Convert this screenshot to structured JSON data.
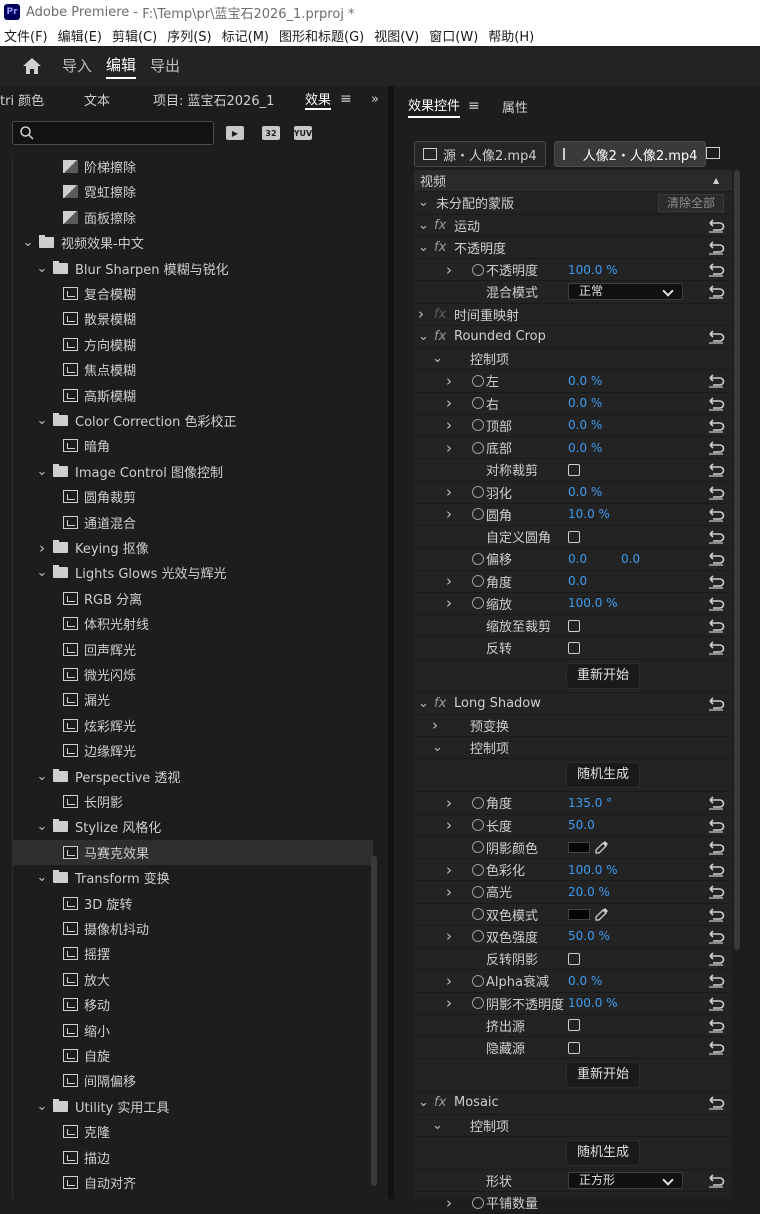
{
  "titlebar": {
    "app": "Adobe Premiere",
    "sep": " - ",
    "path": "F:\\Temp\\pr\\蓝宝石2026_1.prproj *"
  },
  "menu": [
    "文件(F)",
    "编辑(E)",
    "剪辑(C)",
    "序列(S)",
    "标记(M)",
    "图形和标题(G)",
    "视图(V)",
    "窗口(W)",
    "帮助(H)"
  ],
  "workspace": {
    "tabs": [
      "导入",
      "编辑",
      "导出"
    ],
    "active": "编辑"
  },
  "left": {
    "tabs": [
      "tri 颜色",
      "文本",
      "项目: 蓝宝石2026_1",
      "效果"
    ],
    "active_tab": "效果",
    "search_placeholder": "",
    "tool_badges": [
      "32",
      "YUV"
    ],
    "tree": [
      {
        "kind": "tr",
        "indent": 2,
        "label": "阶梯擦除"
      },
      {
        "kind": "tr",
        "indent": 2,
        "label": "霓虹擦除"
      },
      {
        "kind": "tr",
        "indent": 2,
        "label": "面板擦除"
      },
      {
        "kind": "folder",
        "indent": 0,
        "open": true,
        "label": "视频效果-中文"
      },
      {
        "kind": "folder",
        "indent": 1,
        "open": true,
        "label": "Blur  Sharpen 模糊与锐化"
      },
      {
        "kind": "fx",
        "indent": 2,
        "label": "复合模糊"
      },
      {
        "kind": "fx",
        "indent": 2,
        "label": "散景模糊"
      },
      {
        "kind": "fx",
        "indent": 2,
        "label": "方向模糊"
      },
      {
        "kind": "fx",
        "indent": 2,
        "label": "焦点模糊"
      },
      {
        "kind": "fx",
        "indent": 2,
        "label": "高斯模糊"
      },
      {
        "kind": "folder",
        "indent": 1,
        "open": true,
        "label": "Color Correction 色彩校正"
      },
      {
        "kind": "fx",
        "indent": 2,
        "label": "暗角"
      },
      {
        "kind": "folder",
        "indent": 1,
        "open": true,
        "label": "Image Control 图像控制"
      },
      {
        "kind": "fx",
        "indent": 2,
        "label": "圆角裁剪"
      },
      {
        "kind": "fx",
        "indent": 2,
        "label": "通道混合"
      },
      {
        "kind": "folder",
        "indent": 1,
        "open": false,
        "label": "Keying 抠像"
      },
      {
        "kind": "folder",
        "indent": 1,
        "open": true,
        "label": "Lights  Glows 光效与辉光"
      },
      {
        "kind": "fx",
        "indent": 2,
        "label": "RGB 分离"
      },
      {
        "kind": "fx",
        "indent": 2,
        "label": "体积光射线"
      },
      {
        "kind": "fx",
        "indent": 2,
        "label": "回声辉光"
      },
      {
        "kind": "fx",
        "indent": 2,
        "label": "微光闪烁"
      },
      {
        "kind": "fx",
        "indent": 2,
        "label": "漏光"
      },
      {
        "kind": "fx",
        "indent": 2,
        "label": "炫彩辉光"
      },
      {
        "kind": "fx",
        "indent": 2,
        "label": "边缘辉光"
      },
      {
        "kind": "folder",
        "indent": 1,
        "open": true,
        "label": "Perspective 透视"
      },
      {
        "kind": "fx",
        "indent": 2,
        "label": "长阴影"
      },
      {
        "kind": "folder",
        "indent": 1,
        "open": true,
        "label": "Stylize 风格化"
      },
      {
        "kind": "fx",
        "indent": 2,
        "label": "马赛克效果",
        "selected": true
      },
      {
        "kind": "folder",
        "indent": 1,
        "open": true,
        "label": "Transform 变换"
      },
      {
        "kind": "fx",
        "indent": 2,
        "label": "3D 旋转"
      },
      {
        "kind": "fx",
        "indent": 2,
        "label": "摄像机抖动"
      },
      {
        "kind": "fx",
        "indent": 2,
        "label": "摇摆"
      },
      {
        "kind": "fx",
        "indent": 2,
        "label": "放大"
      },
      {
        "kind": "fx",
        "indent": 2,
        "label": "移动"
      },
      {
        "kind": "fx",
        "indent": 2,
        "label": "缩小"
      },
      {
        "kind": "fx",
        "indent": 2,
        "label": "自旋"
      },
      {
        "kind": "fx",
        "indent": 2,
        "label": "间隔偏移"
      },
      {
        "kind": "folder",
        "indent": 1,
        "open": true,
        "label": "Utility 实用工具"
      },
      {
        "kind": "fx",
        "indent": 2,
        "label": "克隆"
      },
      {
        "kind": "fx",
        "indent": 2,
        "label": "描边"
      },
      {
        "kind": "fx",
        "indent": 2,
        "label": "自动对齐"
      }
    ]
  },
  "right": {
    "tabs": [
      "效果控件",
      "属性"
    ],
    "active_tab": "效果控件",
    "source_clip": "源・人像2.mp4",
    "seq_clip": "人像2・人像2.mp4",
    "rows": [
      {
        "t": "header",
        "label": "视频"
      },
      {
        "t": "mask",
        "arrow": "v",
        "label": "未分配的蒙版",
        "button": "清除全部"
      },
      {
        "t": "effect",
        "arrow": "v",
        "fx": true,
        "label": "运动",
        "reset": true
      },
      {
        "t": "effect",
        "arrow": "v",
        "fx": true,
        "label": "不透明度",
        "reset": true
      },
      {
        "t": "param",
        "arrow": ">",
        "sw": true,
        "label": "不透明度",
        "val": "100.0 %",
        "reset": true
      },
      {
        "t": "param",
        "label": "混合模式",
        "dd": "正常",
        "reset": true
      },
      {
        "t": "effect",
        "arrow": ">",
        "fx": true,
        "fxdim": true,
        "label": "时间重映射"
      },
      {
        "t": "effect",
        "arrow": "v",
        "fx": true,
        "label": "Rounded Crop",
        "reset": true
      },
      {
        "t": "group",
        "arrow": "v",
        "label": "控制项"
      },
      {
        "t": "param",
        "arrow": ">",
        "sw": true,
        "label": "左",
        "val": "0.0 %",
        "reset": true
      },
      {
        "t": "param",
        "arrow": ">",
        "sw": true,
        "label": "右",
        "val": "0.0 %",
        "reset": true
      },
      {
        "t": "param",
        "arrow": ">",
        "sw": true,
        "label": "顶部",
        "val": "0.0 %",
        "reset": true
      },
      {
        "t": "param",
        "arrow": ">",
        "sw": true,
        "label": "底部",
        "val": "0.0 %",
        "reset": true
      },
      {
        "t": "param",
        "label": "对称裁剪",
        "cb": true,
        "reset": true
      },
      {
        "t": "param",
        "arrow": ">",
        "sw": true,
        "label": "羽化",
        "val": "0.0 %",
        "reset": true
      },
      {
        "t": "param",
        "arrow": ">",
        "sw": true,
        "label": "圆角",
        "val": "10.0 %",
        "reset": true
      },
      {
        "t": "param",
        "label": "自定义圆角",
        "cb": true,
        "reset": true
      },
      {
        "t": "param",
        "sw": true,
        "label": "偏移",
        "val": "0.0",
        "val2": "0.0",
        "reset": true
      },
      {
        "t": "param",
        "arrow": ">",
        "sw": true,
        "label": "角度",
        "val": "0.0",
        "reset": true
      },
      {
        "t": "param",
        "arrow": ">",
        "sw": true,
        "label": "缩放",
        "val": "100.0 %",
        "reset": true
      },
      {
        "t": "param",
        "label": "缩放至裁剪",
        "cb": true,
        "reset": true
      },
      {
        "t": "param",
        "label": "反转",
        "cb": true,
        "reset": true
      },
      {
        "t": "button",
        "label": "重新开始"
      },
      {
        "t": "effect",
        "arrow": "v",
        "fx": true,
        "label": "Long Shadow",
        "reset": true
      },
      {
        "t": "group",
        "arrow": ">",
        "label": "预变换"
      },
      {
        "t": "group",
        "arrow": "v",
        "label": "控制项"
      },
      {
        "t": "button",
        "label": "随机生成"
      },
      {
        "t": "param",
        "arrow": ">",
        "sw": true,
        "label": "角度",
        "val": "135.0 °",
        "reset": true
      },
      {
        "t": "param",
        "arrow": ">",
        "sw": true,
        "label": "长度",
        "val": "50.0",
        "reset": true
      },
      {
        "t": "param",
        "sw": true,
        "label": "阴影颜色",
        "swatch": true,
        "reset": true
      },
      {
        "t": "param",
        "arrow": ">",
        "sw": true,
        "label": "色彩化",
        "val": "100.0 %",
        "reset": true
      },
      {
        "t": "param",
        "arrow": ">",
        "sw": true,
        "label": "高光",
        "val": "20.0 %",
        "reset": true
      },
      {
        "t": "param",
        "sw": true,
        "label": "双色模式",
        "swatch": true,
        "reset": true
      },
      {
        "t": "param",
        "arrow": ">",
        "sw": true,
        "label": "双色强度",
        "val": "50.0 %",
        "reset": true
      },
      {
        "t": "param",
        "label": "反转阴影",
        "cb": true,
        "reset": true
      },
      {
        "t": "param",
        "arrow": ">",
        "sw": true,
        "label": "Alpha衰减",
        "val": "0.0 %",
        "reset": true
      },
      {
        "t": "param",
        "arrow": ">",
        "sw": true,
        "label": "阴影不透明度",
        "val": "100.0 %",
        "reset": true
      },
      {
        "t": "param",
        "label": "挤出源",
        "cb": true,
        "reset": true
      },
      {
        "t": "param",
        "label": "隐藏源",
        "cb": true,
        "reset": true
      },
      {
        "t": "button",
        "label": "重新开始"
      },
      {
        "t": "effect",
        "arrow": "v",
        "fx": true,
        "label": "Mosaic",
        "reset": true
      },
      {
        "t": "group",
        "arrow": "v",
        "label": "控制项"
      },
      {
        "t": "button",
        "label": "随机生成"
      },
      {
        "t": "param",
        "label": "形状",
        "dd": "正方形",
        "reset": true
      },
      {
        "t": "param",
        "arrow": ">",
        "sw": true,
        "label": "平铺数量"
      }
    ]
  }
}
